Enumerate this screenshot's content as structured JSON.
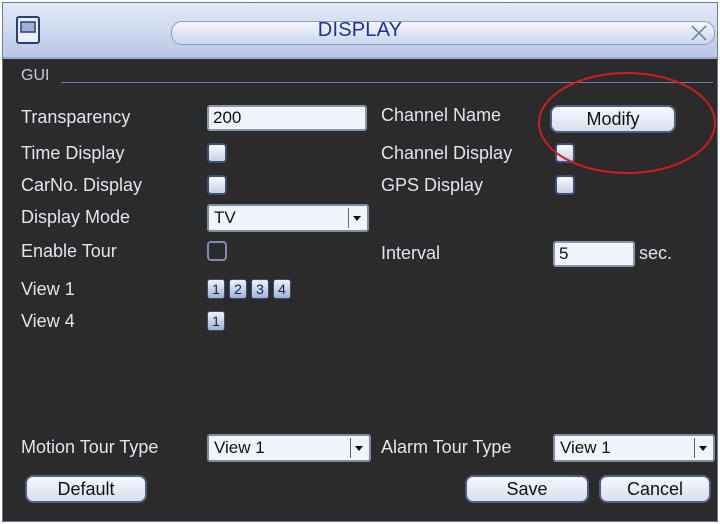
{
  "window": {
    "title": "DISPLAY",
    "close_glyph": "✕"
  },
  "section": {
    "label": "GUI"
  },
  "transparency": {
    "label": "Transparency",
    "value": "200"
  },
  "channel_name": {
    "label": "Channel Name",
    "button": "Modify"
  },
  "time_display": {
    "label": "Time Display",
    "checked": false
  },
  "channel_display": {
    "label": "Channel Display",
    "checked": false
  },
  "carno_display": {
    "label": "CarNo. Display",
    "checked": false
  },
  "gps_display": {
    "label": "GPS Display",
    "checked": false
  },
  "display_mode": {
    "label": "Display Mode",
    "value": "TV"
  },
  "enable_tour": {
    "label": "Enable Tour",
    "checked": false
  },
  "interval": {
    "label": "Interval",
    "value": "5",
    "unit": "sec."
  },
  "view1": {
    "label": "View 1",
    "buttons": [
      "1",
      "2",
      "3",
      "4"
    ]
  },
  "view4": {
    "label": "View 4",
    "buttons": [
      "1"
    ]
  },
  "motion_tour": {
    "label": "Motion Tour Type",
    "value": "View 1"
  },
  "alarm_tour": {
    "label": "Alarm Tour Type",
    "value": "View 1"
  },
  "buttons": {
    "default": "Default",
    "save": "Save",
    "cancel": "Cancel"
  },
  "colors": {
    "background": "#2b2b2b",
    "title_text": "#1a2eb8",
    "annotation": "#d21c1c"
  }
}
